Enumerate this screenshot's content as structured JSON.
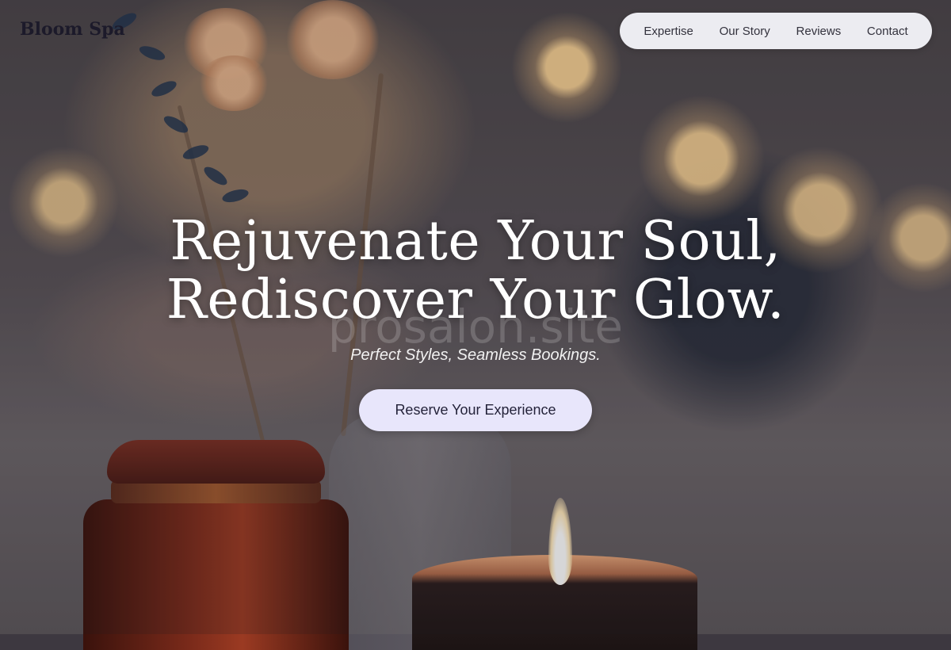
{
  "brand": {
    "name": "Bloom Spa"
  },
  "nav": {
    "items": [
      {
        "label": "Expertise"
      },
      {
        "label": "Our Story"
      },
      {
        "label": "Reviews"
      },
      {
        "label": "Contact"
      }
    ]
  },
  "hero": {
    "headline_line1": "Rejuvenate Your Soul,",
    "headline_line2": "Rediscover Your Glow.",
    "subtitle": "Perfect Styles, Seamless Bookings.",
    "cta_label": "Reserve Your Experience",
    "watermark": "prosalon.site"
  },
  "colors": {
    "nav_bg": "#ececf1",
    "cta_bg": "#e8e6fb",
    "brand_text": "#1c1a2a"
  }
}
